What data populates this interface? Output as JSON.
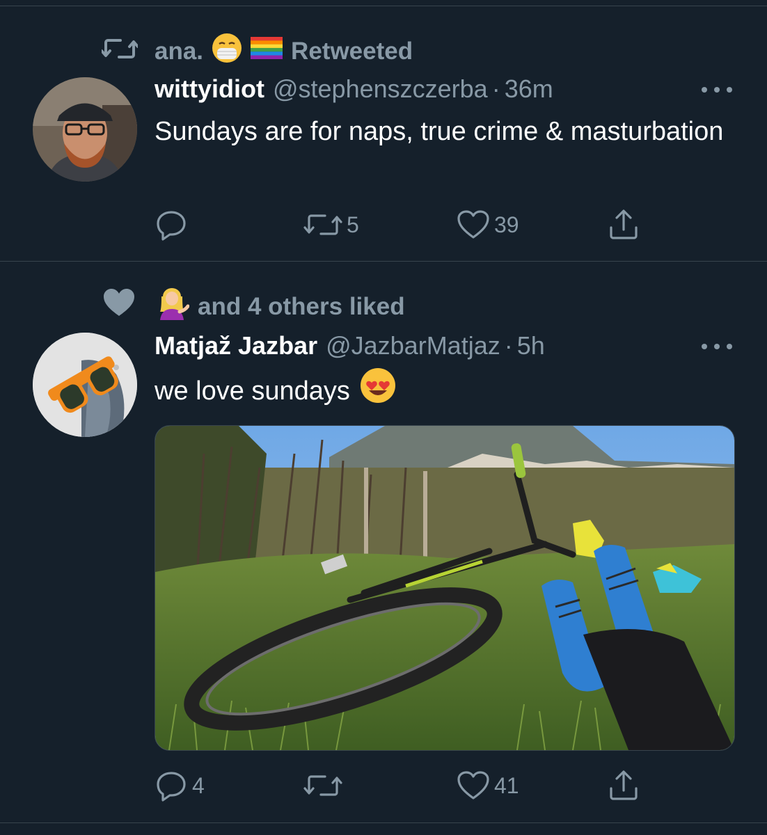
{
  "colors": {
    "background": "#15202b",
    "divider": "#38444d",
    "secondary_text": "#8899a6",
    "primary_text": "#ffffff"
  },
  "tweets": [
    {
      "context": {
        "icon": "retweet-icon",
        "user": "ana.",
        "emojis": [
          "face-with-medical-mask",
          "rainbow-flag"
        ],
        "label": "Retweeted"
      },
      "avatar": "avatar-wittyidiot",
      "name": "wittyidiot",
      "handle": "@stephenszczerba",
      "dot": "·",
      "time": "36m",
      "text": "Sundays are for naps, true crime & masturbation",
      "actions": {
        "reply_count": "",
        "retweet_count": "5",
        "like_count": "39"
      }
    },
    {
      "context": {
        "icon": "heart-icon",
        "emoji": "person-tipping-hand",
        "label": "and 4 others liked"
      },
      "avatar": "avatar-matjaz",
      "name": "Matjaž Jazbar",
      "handle": "@JazbarMatjaz",
      "dot": "·",
      "time": "5h",
      "text": "we love sundays",
      "text_emoji": "smiling-face-with-heart-eyes",
      "media": "mountain-bike-on-grass-photo",
      "actions": {
        "reply_count": "4",
        "retweet_count": "",
        "like_count": "41"
      }
    }
  ]
}
